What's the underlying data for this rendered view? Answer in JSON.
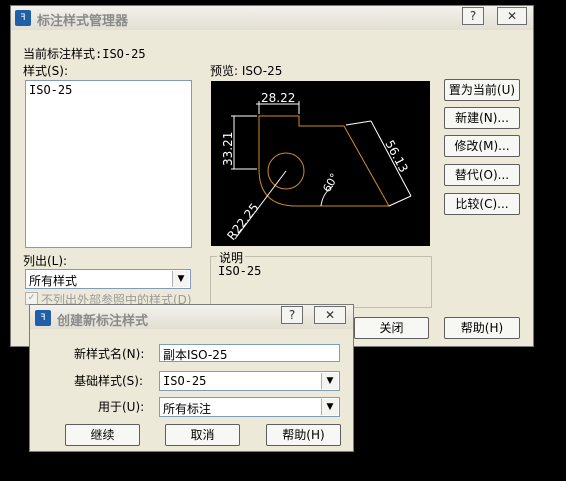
{
  "manager": {
    "title": "标注样式管理器",
    "help_symbol": "?",
    "close_symbol": "✕",
    "current_style_label": "当前标注样式:ISO-25",
    "styles_label": "样式(S):",
    "styles": [
      "ISO-25"
    ],
    "preview_label": "预览: ISO-25",
    "list_label": "列出(L):",
    "list_value": "所有样式",
    "exclude_xref_label": "不列出外部参照中的样式(D)",
    "exclude_xref_checked": true,
    "desc_label": "说明",
    "desc_value": "ISO-25",
    "buttons": {
      "set_current": "置为当前(U)",
      "new": "新建(N)...",
      "modify": "修改(M)...",
      "override": "替代(O)...",
      "compare": "比较(C)...",
      "close": "关闭",
      "help": "帮助(H)"
    },
    "preview_dims": {
      "top": "28.22",
      "left": "33.21",
      "slant": "56.13",
      "angle": "60°",
      "radius": "R22.25"
    }
  },
  "create": {
    "title": "创建新标注样式",
    "help_symbol": "?",
    "close_symbol": "✕",
    "new_name_label": "新样式名(N):",
    "new_name_value": "副本ISO-25",
    "base_label": "基础样式(S):",
    "base_value": "ISO-25",
    "use_label": "用于(U):",
    "use_value": "所有标注",
    "buttons": {
      "continue": "继续",
      "cancel": "取消",
      "help": "帮助(H)"
    }
  },
  "colors": {
    "dialog_bg": "#ece9d8",
    "preview_bg": "#000000",
    "preview_geom": "#d08a2a",
    "preview_dim": "#ffffff"
  }
}
